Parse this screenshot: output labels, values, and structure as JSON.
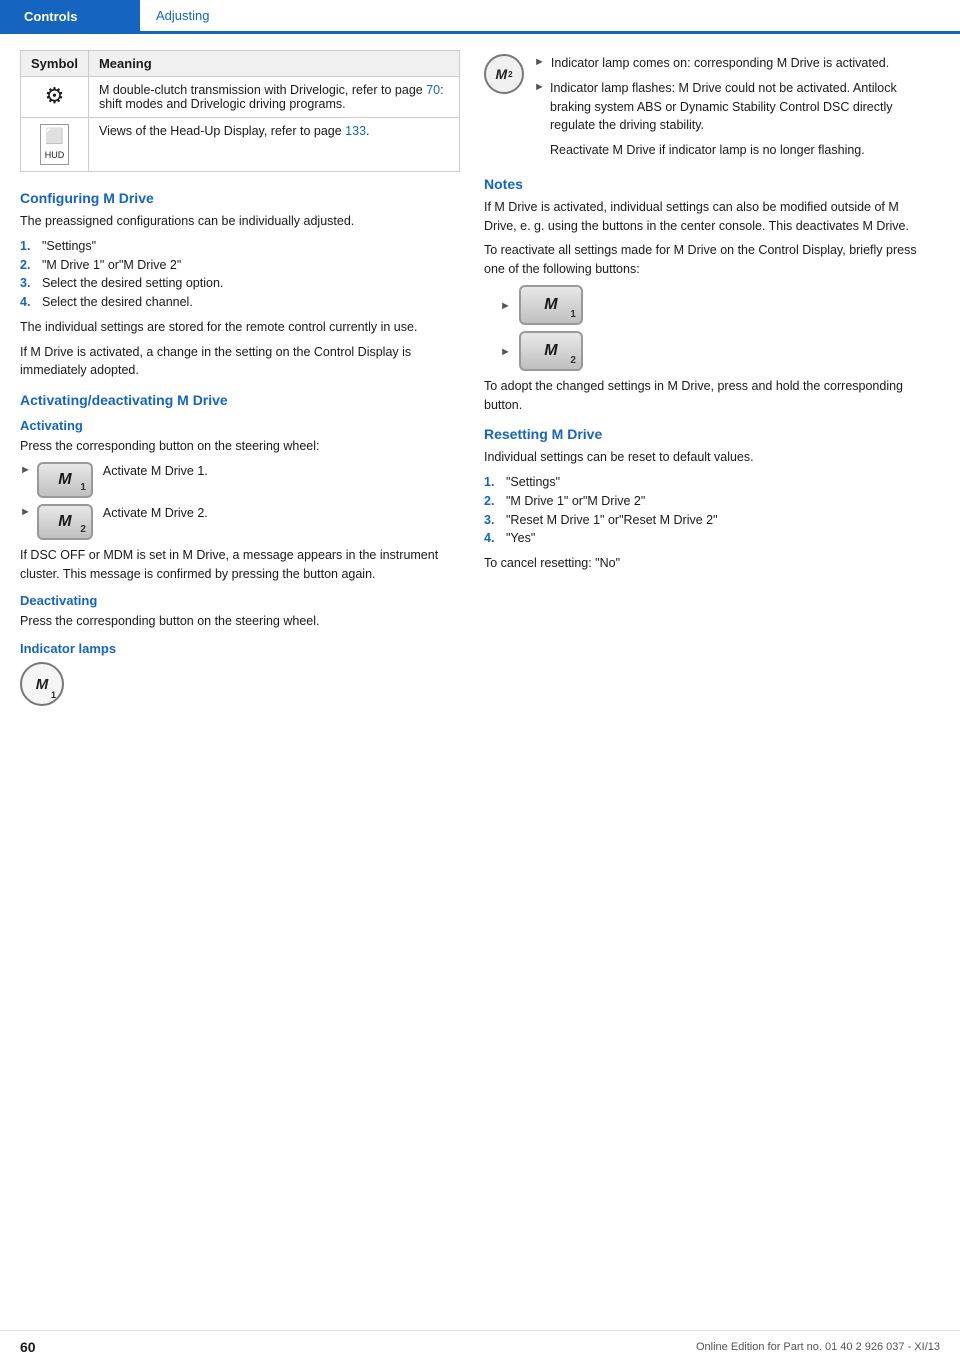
{
  "header": {
    "controls_label": "Controls",
    "adjusting_label": "Adjusting"
  },
  "table": {
    "col1": "Symbol",
    "col2": "Meaning",
    "rows": [
      {
        "symbol_type": "gearbox",
        "meaning": "M double-clutch transmission with Drivelogic, refer to page 70: shift modes and Drivelogic driving programs.",
        "link_page": "70"
      },
      {
        "symbol_type": "hud",
        "meaning": "Views of the Head-Up Display, refer to page 133.",
        "link_page": "133"
      }
    ]
  },
  "left": {
    "configuring_heading": "Configuring M Drive",
    "configuring_intro": "The preassigned configurations can be individually adjusted.",
    "configuring_steps": [
      {
        "num": "1.",
        "text": "\"Settings\""
      },
      {
        "num": "2.",
        "text": "\"M Drive 1\" or\"M Drive 2\""
      },
      {
        "num": "3.",
        "text": "Select the desired setting option."
      },
      {
        "num": "4.",
        "text": "Select the desired channel."
      }
    ],
    "configuring_note1": "The individual settings are stored for the remote control currently in use.",
    "configuring_note2": "If M Drive is activated, a change in the setting on the Control Display is immediately adopted.",
    "activating_heading": "Activating/deactivating M Drive",
    "activating_sub": "Activating",
    "activating_intro": "Press the corresponding button on the steering wheel:",
    "activate1_label": "Activate M Drive 1.",
    "activate2_label": "Activate M Drive 2.",
    "dsc_off_text": "If DSC OFF or MDM is set in M Drive, a message appears in the instrument cluster. This message is confirmed by pressing the button again.",
    "deactivating_sub": "Deactivating",
    "deactivating_text": "Press the corresponding button on the steering wheel.",
    "indicator_lamps_sub": "Indicator lamps"
  },
  "right": {
    "indicator_bullets": [
      "Indicator lamp comes on: corresponding M Drive is activated.",
      "Indicator lamp flashes: M Drive could not be activated. Antilock braking system ABS or Dynamic Stability Control DSC directly regulate the driving stability.",
      "Reactivate M Drive if indicator lamp is no longer flashing."
    ],
    "notes_heading": "Notes",
    "notes_text1": "If M Drive is activated, individual settings can also be modified outside of M Drive, e. g. using the buttons in the center console. This deactivates M Drive.",
    "notes_text2": "To reactivate all settings made for M Drive on the Control Display, briefly press one of the following buttons:",
    "adopt_text": "To adopt the changed settings in M Drive, press and hold the corresponding button.",
    "resetting_heading": "Resetting M Drive",
    "resetting_intro": "Individual settings can be reset to default values.",
    "resetting_steps": [
      {
        "num": "1.",
        "text": "\"Settings\""
      },
      {
        "num": "2.",
        "text": "\"M Drive 1\" or\"M Drive 2\""
      },
      {
        "num": "3.",
        "text": "\"Reset M Drive 1\" or\"Reset M Drive 2\""
      },
      {
        "num": "4.",
        "text": "\"Yes\""
      }
    ],
    "cancel_text": "To cancel resetting: \"No\""
  },
  "footer": {
    "page": "60",
    "edition": "Online Edition for Part no. 01 40 2 926 037 - XI/13"
  }
}
